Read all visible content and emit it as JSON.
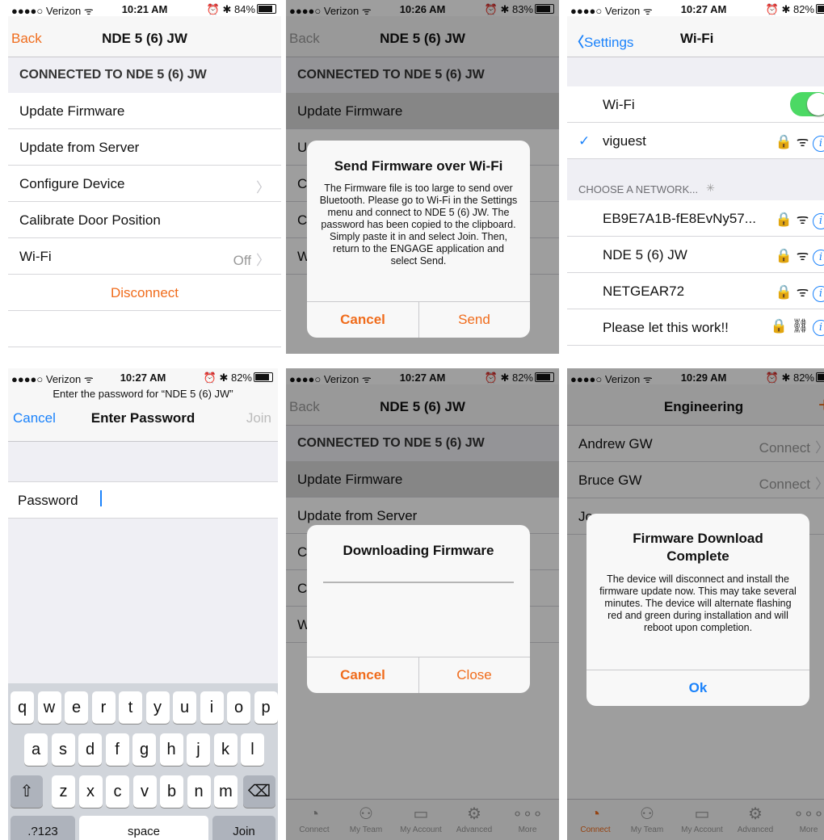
{
  "colors": {
    "accent": "#f06c1c",
    "ios_blue": "#1a82fb",
    "switch_green": "#4cd964"
  },
  "s1": {
    "status": {
      "carrier": "●●●●○ Verizon ᯤ",
      "time": "10:21 AM",
      "battery": "⏰ ✱ 84%"
    },
    "back": "Back",
    "title": "NDE  5 (6) JW",
    "section": "CONNECTED TO NDE  5 (6) JW",
    "rows": [
      {
        "label": "Update Firmware"
      },
      {
        "label": "Update from Server"
      },
      {
        "label": "Configure Device"
      },
      {
        "label": "Calibrate Door Position"
      },
      {
        "label": "Wi-Fi",
        "value": "Off"
      }
    ],
    "disconnect": "Disconnect"
  },
  "s2": {
    "status": {
      "carrier": "●●●●○ Verizon ᯤ",
      "time": "10:26 AM",
      "battery": "⏰ ✱ 83%"
    },
    "back": "Back",
    "title": "NDE  5 (6) JW",
    "section": "CONNECTED TO NDE  5 (6) JW",
    "row1": "Update Firmware",
    "alert": {
      "title": "Send Firmware over Wi-Fi",
      "message": "The Firmware file is too large to send over Bluetooth.  Please go to Wi-Fi in the Settings menu and connect to NDE 5 (6) JW.  The password has been copied to the clipboard.  Simply paste it in and select Join.  Then, return to the ENGAGE application and select Send.",
      "cancel": "Cancel",
      "send": "Send"
    }
  },
  "s3": {
    "status": {
      "carrier": "●●●●○ Verizon ᯤ",
      "time": "10:27 AM",
      "battery": "⏰ ✱ 82%"
    },
    "back": "Settings",
    "title": "Wi-Fi",
    "wifi_label": "Wi-Fi",
    "wifi_on": true,
    "connected": "viguest",
    "choose": "CHOOSE A NETWORK...",
    "networks": [
      "EB9E7A1B-fE8EvNy57...",
      "NDE  5 (6) JW",
      "NETGEAR72",
      "Please let this work!!"
    ]
  },
  "s4": {
    "status": {
      "carrier": "●●●●○ Verizon ᯤ",
      "time": "10:27 AM",
      "battery": "⏰ ✱ 82%"
    },
    "prompt": "Enter the password for “NDE  5 (6) JW”",
    "cancel": "Cancel",
    "title": "Enter Password",
    "join": "Join",
    "password_label": "Password",
    "keys_row1": [
      "q",
      "w",
      "e",
      "r",
      "t",
      "y",
      "u",
      "i",
      "o",
      "p"
    ],
    "keys_row2": [
      "a",
      "s",
      "d",
      "f",
      "g",
      "h",
      "j",
      "k",
      "l"
    ],
    "keys_row3": [
      "z",
      "x",
      "c",
      "v",
      "b",
      "n",
      "m"
    ],
    "shift": "⇧",
    "delete": "⌫",
    "numbers": ".?123",
    "space": "space",
    "join_key": "Join"
  },
  "s5": {
    "status": {
      "carrier": "●●●●○ Verizon ᯤ",
      "time": "10:27 AM",
      "battery": "⏰ ✱ 82%"
    },
    "back": "Back",
    "title": "NDE  5 (6) JW",
    "section": "CONNECTED TO NDE  5 (6) JW",
    "row1": "Update Firmware",
    "row2": "Update from Server",
    "alert": {
      "title": "Downloading Firmware",
      "progress": 0.0,
      "cancel": "Cancel",
      "close": "Close"
    },
    "tabs": [
      "Connect",
      "My Team",
      "My Account",
      "Advanced",
      "More"
    ]
  },
  "s6": {
    "status": {
      "carrier": "●●●●○ Verizon ᯤ",
      "time": "10:29 AM",
      "battery": "⏰ ✱ 82%"
    },
    "title": "Engineering",
    "add": "+",
    "rows": [
      {
        "label": "Andrew GW",
        "value": "Connect"
      },
      {
        "label": "Bruce GW",
        "value": "Connect"
      },
      {
        "label": "Jo",
        "value": ""
      }
    ],
    "alert": {
      "title": "Firmware Download Complete",
      "message": "The device will disconnect and install the firmware update now.  This may take several minutes.  The device will alternate flashing red and green during installation and will reboot upon completion.",
      "ok": "Ok"
    },
    "tabs": [
      "Connect",
      "My Team",
      "My Account",
      "Advanced",
      "More"
    ]
  }
}
